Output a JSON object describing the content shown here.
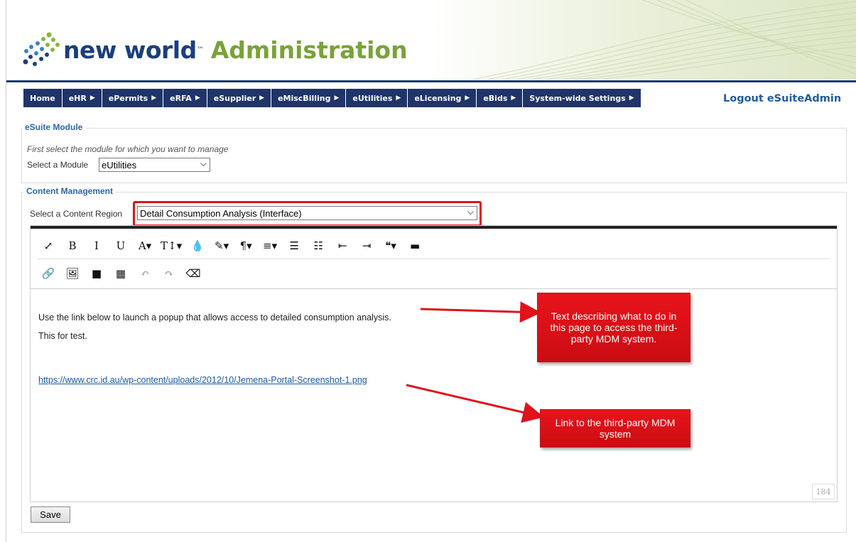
{
  "header": {
    "logo_text": "new world",
    "logo_tm": "™",
    "logo_admin": "Administration"
  },
  "nav": {
    "items": [
      {
        "label": "Home",
        "has_caret": false
      },
      {
        "label": "eHR",
        "has_caret": true
      },
      {
        "label": "ePermits",
        "has_caret": true
      },
      {
        "label": "eRFA",
        "has_caret": true
      },
      {
        "label": "eSupplier",
        "has_caret": true
      },
      {
        "label": "eMiscBilling",
        "has_caret": true
      },
      {
        "label": "eUtilities",
        "has_caret": true
      },
      {
        "label": "eLicensing",
        "has_caret": true
      },
      {
        "label": "eBids",
        "has_caret": true
      },
      {
        "label": "System-wide Settings",
        "has_caret": true
      }
    ],
    "caret": "▶",
    "logout_label": "Logout eSuiteAdmin"
  },
  "module_section": {
    "legend": "eSuite Module",
    "instruction": "First select the module for which you want to manage",
    "select_label": "Select a Module",
    "select_value": "eUtilities"
  },
  "content_section": {
    "legend": "Content Management",
    "select_label": "Select a Content Region",
    "select_value": "Detail Consumption Analysis (Interface)"
  },
  "editor": {
    "toolbar_row1": [
      {
        "icon": "fullscreen-icon",
        "glyph": "⤢"
      },
      {
        "icon": "bold-icon",
        "glyph": "B"
      },
      {
        "icon": "italic-icon",
        "glyph": "I"
      },
      {
        "icon": "underline-icon",
        "glyph": "U"
      },
      {
        "icon": "font-color-icon",
        "glyph": "A▾"
      },
      {
        "icon": "font-size-icon",
        "glyph": "T↕▾"
      },
      {
        "icon": "ink-drop-icon",
        "glyph": "💧"
      },
      {
        "icon": "magic-wand-icon",
        "glyph": "✎▾"
      },
      {
        "icon": "paragraph-icon",
        "glyph": "¶▾"
      },
      {
        "icon": "align-icon",
        "glyph": "≡▾"
      },
      {
        "icon": "ordered-list-icon",
        "glyph": "☰"
      },
      {
        "icon": "unordered-list-icon",
        "glyph": "☷"
      },
      {
        "icon": "outdent-icon",
        "glyph": "⇤"
      },
      {
        "icon": "indent-icon",
        "glyph": "⇥"
      },
      {
        "icon": "quote-icon",
        "glyph": "❝▾"
      },
      {
        "icon": "horizontal-rule-icon",
        "glyph": "▬"
      }
    ],
    "toolbar_row2": [
      {
        "icon": "link-icon",
        "glyph": "🔗"
      },
      {
        "icon": "image-icon",
        "glyph": "🖼"
      },
      {
        "icon": "video-icon",
        "glyph": "■"
      },
      {
        "icon": "table-icon",
        "glyph": "▦"
      },
      {
        "icon": "undo-icon",
        "glyph": "↶"
      },
      {
        "icon": "redo-icon",
        "glyph": "↷"
      },
      {
        "icon": "eraser-icon",
        "glyph": "⌫"
      }
    ],
    "body": {
      "paragraph1": "Use the link below to launch a popup that allows access to detailed consumption analysis.",
      "paragraph2": "This for test.",
      "link": "https://www.crc.id.au/wp-content/uploads/2012/10/Jemena-Portal-Screenshot-1.png"
    },
    "char_count": "184"
  },
  "save_label": "Save",
  "annotations": {
    "callout1": "Text describing what to do in this page to access the third-party MDM system.",
    "callout2": "Link to the third-party MDM system",
    "accent_color": "#e0121a"
  }
}
